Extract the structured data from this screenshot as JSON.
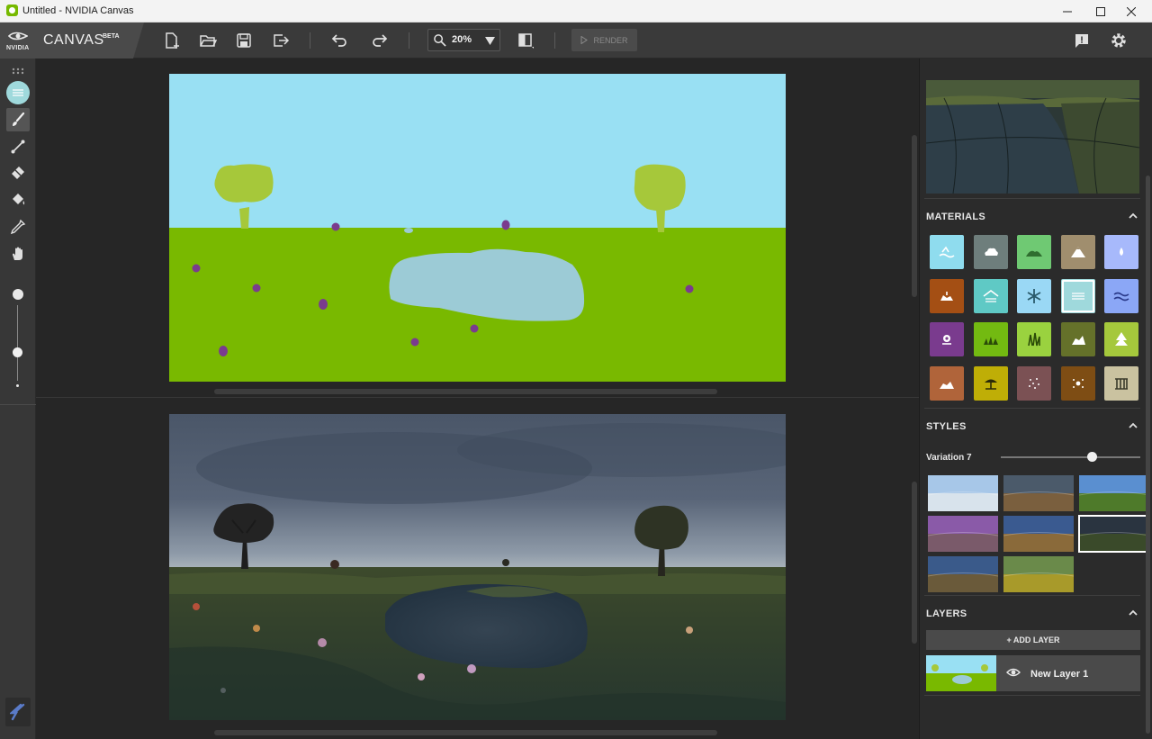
{
  "window": {
    "title": "Untitled - NVIDIA Canvas",
    "controls": [
      "minimize-icon",
      "maximize-icon",
      "close-icon"
    ]
  },
  "brand": {
    "company": "NVIDIA",
    "product": "CANVAS",
    "badge": "BETA"
  },
  "toolbar": {
    "buttons": [
      "new-file-icon",
      "open-folder-icon",
      "save-icon",
      "export-icon",
      "undo-icon",
      "redo-icon",
      "compare-view-icon"
    ],
    "zoom_value": "20%",
    "render_label": "RENDER",
    "right_buttons": [
      "feedback-icon",
      "settings-icon"
    ]
  },
  "tools": [
    "grip-icon",
    "material-swatch-icon",
    "brush-icon",
    "line-icon",
    "eraser-icon",
    "fill-bucket-icon",
    "eyedropper-icon",
    "pan-hand-icon"
  ],
  "brush_size": {
    "level": 0.3
  },
  "colors": {
    "sky": "#99e0f3",
    "grass": "#79b900",
    "tree": "#a6c83a",
    "water": "#9ccbd6",
    "flower": "#7a3b8e",
    "selected_material": "#9fd9dc"
  },
  "materials": {
    "title": "MATERIALS",
    "items": [
      {
        "name": "sea",
        "color": "#8fdcee"
      },
      {
        "name": "cloud",
        "color": "#6e7e7c"
      },
      {
        "name": "hill",
        "color": "#6fc973"
      },
      {
        "name": "mountain",
        "color": "#a08e6e"
      },
      {
        "name": "fog",
        "color": "#a7b9fb"
      },
      {
        "name": "mud",
        "color": "#a44f14"
      },
      {
        "name": "snow-roof",
        "color": "#5fc9c5"
      },
      {
        "name": "snow",
        "color": "#9ad8f5"
      },
      {
        "name": "water",
        "color": "#9fd9dc",
        "selected": true
      },
      {
        "name": "river",
        "color": "#8ba7f6"
      },
      {
        "name": "flower",
        "color": "#7a3b8e"
      },
      {
        "name": "grass",
        "color": "#73ba11"
      },
      {
        "name": "tall-grass",
        "color": "#9ad23f"
      },
      {
        "name": "rock",
        "color": "#65712a"
      },
      {
        "name": "tree",
        "color": "#a5c83c"
      },
      {
        "name": "dirt",
        "color": "#b0643a"
      },
      {
        "name": "beach",
        "color": "#bfae06"
      },
      {
        "name": "sand",
        "color": "#7b5154"
      },
      {
        "name": "gravel",
        "color": "#7e4d14"
      },
      {
        "name": "structure",
        "color": "#cac2a0"
      }
    ]
  },
  "styles": {
    "title": "STYLES",
    "variation_label": "Variation 7",
    "variation_level": 0.7,
    "thumbs": [
      {
        "sky": "#a7c7e8",
        "ground": "#d8e3ec"
      },
      {
        "sky": "#4b5a6a",
        "ground": "#7a5f3e"
      },
      {
        "sky": "#5a8fd0",
        "ground": "#4e7a2a"
      },
      {
        "sky": "#8a5aa8",
        "ground": "#7a5a6a"
      },
      {
        "sky": "#3a5a90",
        "ground": "#8a6a3a"
      },
      {
        "sky": "#2a3440",
        "ground": "#3a4a2a",
        "selected": true
      },
      {
        "sky": "#3a5a8a",
        "ground": "#6a5a3a"
      },
      {
        "sky": "#6a8a4a",
        "ground": "#a89a2a"
      }
    ]
  },
  "layers": {
    "title": "LAYERS",
    "add_label": "+ ADD LAYER",
    "items": [
      {
        "name": "New Layer 1",
        "visible": true
      }
    ]
  }
}
